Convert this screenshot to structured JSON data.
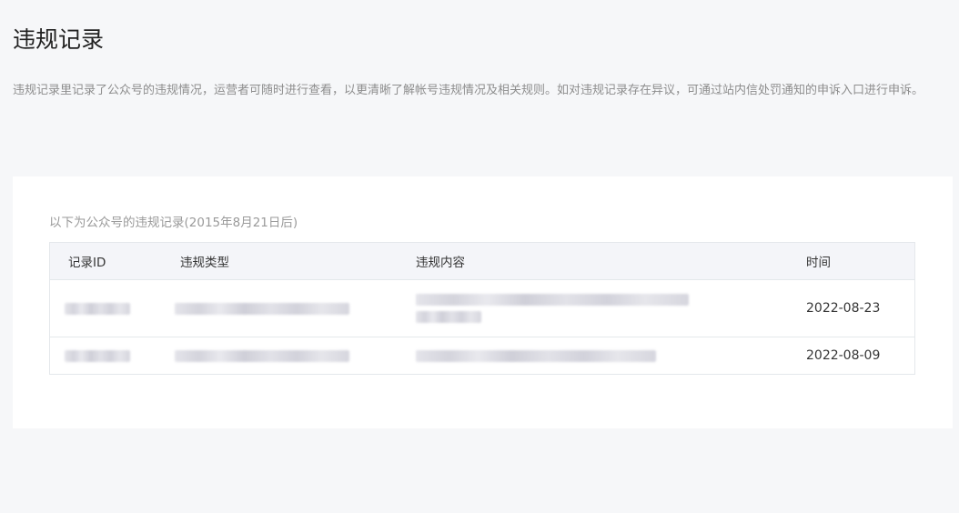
{
  "page": {
    "title": "违规记录",
    "description": "违规记录里记录了公众号的违规情况，运营者可随时进行查看，以更清晰了解帐号违规情况及相关规则。如对违规记录存在异议，可通过站内信处罚通知的申诉入口进行申诉。"
  },
  "table": {
    "caption": "以下为公众号的违规记录(2015年8月21日后)",
    "headers": {
      "id": "记录ID",
      "type": "违规类型",
      "content": "违规内容",
      "time": "时间"
    },
    "rows": [
      {
        "time": "2022-08-23"
      },
      {
        "time": "2022-08-09"
      }
    ]
  }
}
